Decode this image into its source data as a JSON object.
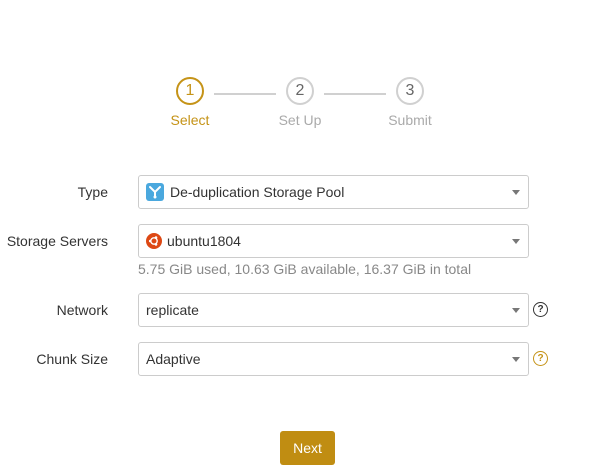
{
  "stepper": {
    "steps": [
      {
        "number": "1",
        "label": "Select",
        "state": "active"
      },
      {
        "number": "2",
        "label": "Set Up",
        "state": "inactive"
      },
      {
        "number": "3",
        "label": "Submit",
        "state": "inactive"
      }
    ]
  },
  "form": {
    "type": {
      "label": "Type",
      "value": "De-duplication Storage Pool",
      "icon": "storage-pool-icon"
    },
    "storage_servers": {
      "label": "Storage Servers",
      "value": "ubuntu1804",
      "icon": "ubuntu-icon",
      "hint": "5.75 GiB used, 10.63 GiB available, 16.37 GiB in total"
    },
    "network": {
      "label": "Network",
      "value": "replicate",
      "help": "?"
    },
    "chunk_size": {
      "label": "Chunk Size",
      "value": "Adaptive",
      "help": "?"
    }
  },
  "actions": {
    "next_label": "Next"
  },
  "colors": {
    "accent": "#c59317",
    "button": "#c08d12",
    "ubuntu": "#dd4814",
    "pool_icon": "#4aa8de"
  }
}
